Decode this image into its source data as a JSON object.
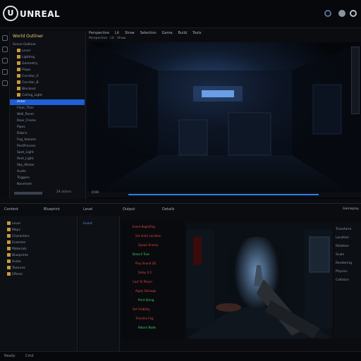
{
  "app": {
    "brand": "UNREAL",
    "logo_letter": "U"
  },
  "colors": {
    "accent": "#1f5fd6",
    "folder": "#c79a3a",
    "code_red": "#e0463c",
    "code_green": "#4cd26a"
  },
  "outliner": {
    "title": "World Outliner",
    "rows": [
      {
        "label": "Scene Outliner",
        "type": "header"
      },
      {
        "label": "Level",
        "type": "folder"
      },
      {
        "label": "Lighting",
        "type": "folder"
      },
      {
        "label": "Geometry",
        "type": "folder"
      },
      {
        "label": "Props",
        "type": "folder"
      },
      {
        "label": "Corridor_A",
        "type": "folder"
      },
      {
        "label": "Corridor_B",
        "type": "folder"
      },
      {
        "label": "Blockout",
        "type": "folder"
      },
      {
        "label": "Ceiling_Light",
        "type": "folder"
      },
      {
        "label": "Actor",
        "type": "selected"
      },
      {
        "label": "Floor_Tiles",
        "type": "item"
      },
      {
        "label": "Wall_Panel",
        "type": "item"
      },
      {
        "label": "Door_Frame",
        "type": "item"
      },
      {
        "label": "Pipes",
        "type": "item"
      },
      {
        "label": "Debris",
        "type": "item"
      },
      {
        "label": "Fog_Volume",
        "type": "item"
      },
      {
        "label": "PostProcess",
        "type": "item"
      },
      {
        "label": "Spot_Light",
        "type": "item"
      },
      {
        "label": "Rect_Light",
        "type": "item"
      },
      {
        "label": "Sky_Atmos",
        "type": "item"
      },
      {
        "label": "Audio",
        "type": "item"
      },
      {
        "label": "Triggers",
        "type": "item"
      },
      {
        "label": "Navmesh",
        "type": "item"
      }
    ],
    "footer": "24 actors"
  },
  "viewport": {
    "menu": [
      "Perspective",
      "Lit",
      "Show",
      "Selection",
      "Game",
      "Build",
      "Tools"
    ],
    "toolbar_label": "Perspective · Lit · Show",
    "timeline_label": "0:00"
  },
  "bottom": {
    "tabs": [
      "Content",
      "Blueprint",
      "Level",
      "Output",
      "Details"
    ],
    "right_label": "Gameplay",
    "tree_items": [
      "Level",
      "Maps",
      "Characters",
      "Enemies",
      "Materials",
      "Blueprints",
      "Audio",
      "Textures",
      "Effects"
    ],
    "mid_items": [
      "Event"
    ],
    "status_left": "Ready",
    "status_right": "Cmd"
  },
  "blueprint": {
    "lines": [
      {
        "text": "Event BeginPlay",
        "color": "#e0463c"
      },
      {
        "text": "Set Actor Location",
        "color": "#e0463c"
      },
      {
        "text": "Spawn Enemy",
        "color": "#e0463c"
      },
      {
        "text": "Branch True",
        "color": "#4cd26a"
      },
      {
        "text": "Play Sound 2D",
        "color": "#e0463c"
      },
      {
        "text": "Delay 0.5",
        "color": "#e0463c"
      },
      {
        "text": "Cast To Player",
        "color": "#e0463c"
      },
      {
        "text": "Apply Damage",
        "color": "#e0463c"
      },
      {
        "text": "Print String",
        "color": "#4cd26a"
      },
      {
        "text": "Set Visibility",
        "color": "#e0463c"
      },
      {
        "text": "Timeline Fog",
        "color": "#e0463c"
      },
      {
        "text": "Return Node",
        "color": "#4cd26a"
      }
    ]
  },
  "details": {
    "rows": [
      "Transform",
      "Location",
      "Rotation",
      "Scale",
      "Rendering",
      "Physics",
      "Collision"
    ]
  }
}
